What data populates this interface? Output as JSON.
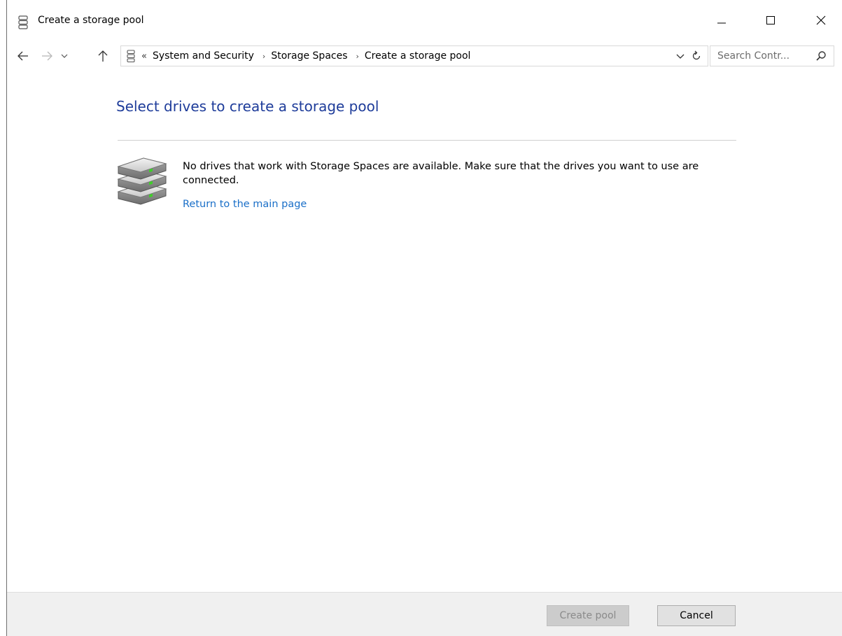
{
  "window": {
    "title": "Create a storage pool",
    "title_icon": "storage-pool-icon"
  },
  "caption_buttons": {
    "minimize_icon": "minimize-icon",
    "maximize_icon": "maximize-icon",
    "close_icon": "close-icon"
  },
  "navigation": {
    "back_icon": "arrow-left-icon",
    "forward_icon": "arrow-right-icon",
    "recent_icon": "chevron-down-icon",
    "up_icon": "arrow-up-icon",
    "address": {
      "overflow": "«",
      "breadcrumbs": [
        "System and Security",
        "Storage Spaces",
        "Create a storage pool"
      ],
      "separator": "›",
      "dropdown_icon": "chevron-down-icon",
      "refresh_icon": "refresh-icon"
    },
    "search": {
      "placeholder": "Search Contr...",
      "icon": "search-icon"
    }
  },
  "content": {
    "heading": "Select drives to create a storage pool",
    "icon": "stacked-drives-icon",
    "message": "No drives that work with Storage Spaces are available. Make sure that the drives you want to use are connected.",
    "link": "Return to the main page"
  },
  "footer": {
    "create_label": "Create pool",
    "cancel_label": "Cancel"
  },
  "colors": {
    "heading": "#1e3c9a",
    "link": "#1a6fc8",
    "footer_bg": "#f0f0f0",
    "drive_led": "#3fcf2a"
  }
}
